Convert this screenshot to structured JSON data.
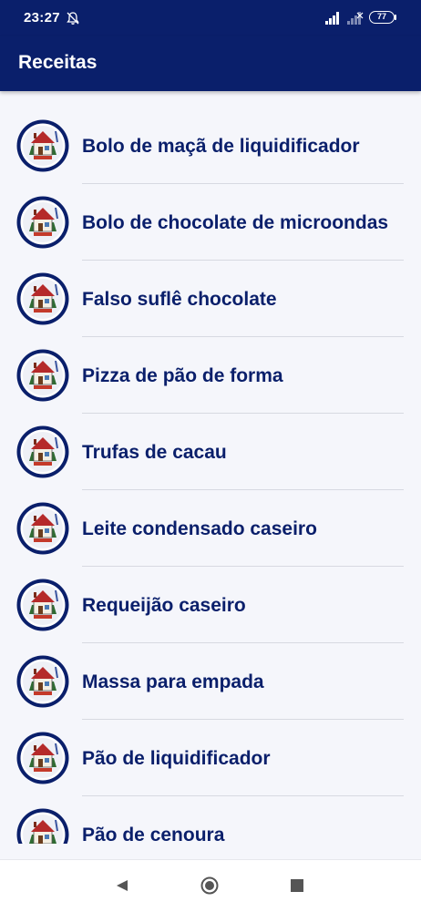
{
  "status_bar": {
    "time": "23:27",
    "battery": "77"
  },
  "app_bar": {
    "title": "Receitas"
  },
  "recipes": [
    {
      "label": "Bolo de maçã de liquidificador"
    },
    {
      "label": "Bolo de chocolate de microondas"
    },
    {
      "label": "Falso suflê chocolate"
    },
    {
      "label": "Pizza de pão de forma"
    },
    {
      "label": "Trufas de cacau"
    },
    {
      "label": "Leite condensado caseiro"
    },
    {
      "label": "Requeijão caseiro"
    },
    {
      "label": "Massa para empada"
    },
    {
      "label": "Pão de liquidificador"
    },
    {
      "label": "Pão de cenoura"
    }
  ],
  "icons": {
    "recipe_icon": "house-logo-icon",
    "bell": "bell-off-icon",
    "back": "back-triangle-icon",
    "home": "home-circle-icon",
    "recent": "recent-square-icon"
  },
  "colors": {
    "primary": "#0a1f6b",
    "background": "#f5f6fb",
    "divider": "#d7d9e1"
  }
}
